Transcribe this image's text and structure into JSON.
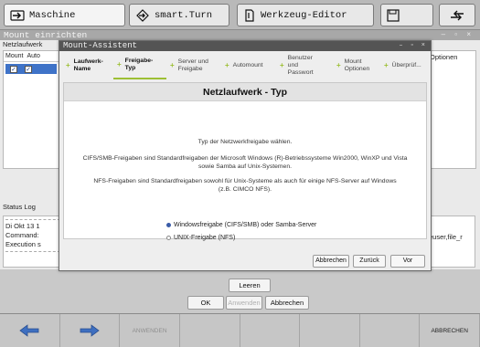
{
  "topbar": {
    "tabs": [
      {
        "label": "Maschine",
        "icon": "arrow-into-box-icon"
      },
      {
        "label": "smart.Turn",
        "icon": "arrow-diamond-icon"
      },
      {
        "label": "Werkzeug-Editor",
        "icon": "tool-icon"
      },
      {
        "label": "",
        "icon": "floppy-disk-icon"
      },
      {
        "label": "",
        "icon": "swap-arrows-icon"
      }
    ]
  },
  "background_window": {
    "title": "Mount einrichten",
    "subtitle": "Netzlaufwerk",
    "table_headers": [
      "Mount",
      "Auto"
    ],
    "right_header": "Optionen",
    "status_label": "Status Log",
    "status_lines": [
      "Di Okt 13 1",
      "Command:",
      "Execution s"
    ],
    "status_right": "euser,file_r",
    "leeren_label": "Leeren",
    "ok_label": "OK",
    "anwenden_label": "Anwenden",
    "abbrechen_label": "Abbrechen"
  },
  "dialog": {
    "title": "Mount-Assistent",
    "steps": [
      {
        "label": "Laufwerk-Name",
        "state": "done"
      },
      {
        "label": "Freigabe-Typ",
        "state": "active"
      },
      {
        "label": "Server und Freigabe",
        "state": "pending"
      },
      {
        "label": "Automount",
        "state": "pending"
      },
      {
        "label": "Benutzer und Passwort",
        "state": "pending"
      },
      {
        "label": "Mount Optionen",
        "state": "pending"
      },
      {
        "label": "Überprüf...",
        "state": "pending"
      }
    ],
    "heading": "Netzlaufwerk - Typ",
    "intro": "Typ der Netzwerkfreigabe wählen.",
    "para_cifs": "CIFS/SMB-Freigaben sind Standardfreigaben der Microsoft Windows (R)-Betriebssysteme Win2000, WinXP und Vista sowie Samba auf Unix-Systemen.",
    "para_nfs": "NFS-Freigaben sind Standardfreigaben sowohl für Unix-Systeme als auch für einige NFS-Server auf Windows (z.B. CIMCO NFS).",
    "option_windows": "Windowsfreigabe (CIFS/SMB) oder Samba-Server",
    "option_unix": "UNIX-Freigabe (NFS)",
    "selected_option": "windows",
    "btn_abbrechen": "Abbrechen",
    "btn_zurueck": "Zurück",
    "btn_vor": "Vor",
    "accent_color": "#9dbf34"
  },
  "softkeys": {
    "keys": [
      "",
      "",
      "ANWENDEN",
      "",
      "",
      "",
      "",
      "ABBRECHEN"
    ]
  }
}
